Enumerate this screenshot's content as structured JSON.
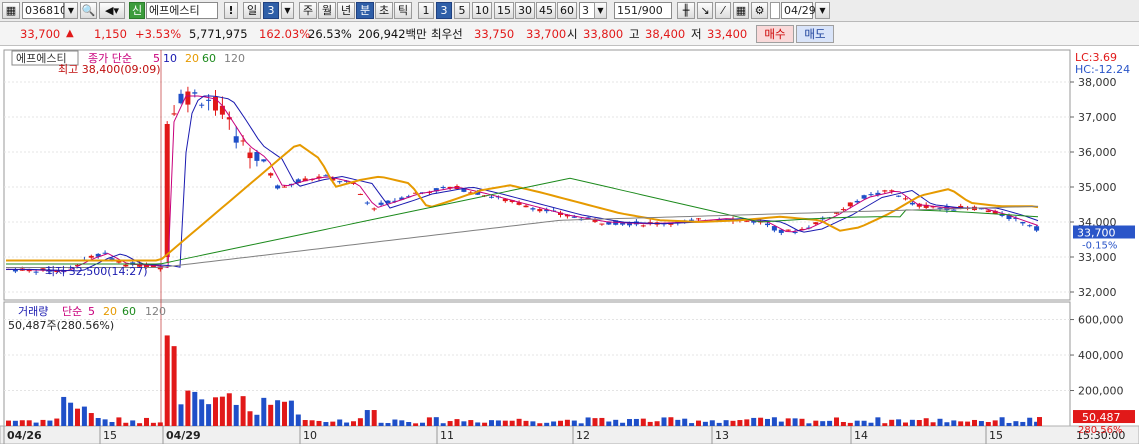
{
  "toolbar": {
    "code": "036810",
    "badge": "신",
    "name": "에프에스티",
    "alert": "!",
    "period_day": "일",
    "period_count": "3",
    "periods": [
      "주",
      "월",
      "년",
      "분",
      "초",
      "틱"
    ],
    "minutes": [
      "1",
      "3",
      "5",
      "10",
      "15",
      "30",
      "45",
      "60"
    ],
    "interval_value": "3",
    "bars": "151",
    "bars_total": "/900",
    "date": "04/29"
  },
  "info": {
    "price": "33,700",
    "direction": "▲",
    "change": "1,150",
    "change_pct": "+3.53%",
    "volume": "5,771,975",
    "volume_ratio": "162.03%",
    "turnover": "26.53%",
    "amount": "206,942백만",
    "best_ask_label": "최우선",
    "best_ask": "33,750",
    "best_bid": "33,700",
    "open_label": "시",
    "open": "33,800",
    "high_label": "고",
    "high": "38,400",
    "low_label": "저",
    "low": "33,400",
    "buy_label": "매수",
    "sell_label": "매도"
  },
  "price_panel": {
    "name_tag": "에프에스티",
    "legend_prefix": "종가 단순",
    "ma_periods": [
      "5",
      "10",
      "20",
      "60",
      "120"
    ],
    "ma_colors": [
      "#c8007c",
      "#1a1ab0",
      "#e69a00",
      "#1c8a1c",
      "#808080"
    ],
    "high_note": "최고 38,400(09:09)",
    "low_note": "최저 32,500(14:27)",
    "lc_label": "LC:3.69",
    "hc_label": "HC:-12.24",
    "y_ticks": [
      "38,000",
      "37,000",
      "36,000",
      "35,000",
      "34,000",
      "33,000",
      "32,000"
    ],
    "current_price": "33,700",
    "current_pct": "-0.15%"
  },
  "volume_panel": {
    "legend_name": "거래량",
    "legend_prefix": "단순",
    "ma_periods": [
      "5",
      "20",
      "60",
      "120"
    ],
    "ma_colors": [
      "#c8007c",
      "#e69a00",
      "#1c8a1c",
      "#808080"
    ],
    "volume_note": "50,487주(280.56%)",
    "y_ticks": [
      "600,000",
      "400,000",
      "200,000"
    ],
    "current_volume": "50,487",
    "current_pct": "280.56%"
  },
  "x_axis": {
    "labels": [
      "04/26",
      "15",
      "04/29",
      "10",
      "11",
      "12",
      "13",
      "14",
      "15"
    ],
    "end_time": "15:30:00"
  },
  "colors": {
    "up": "#e11919",
    "down": "#1f4fc8",
    "toolbar_accent": "#2f5fa8"
  }
}
